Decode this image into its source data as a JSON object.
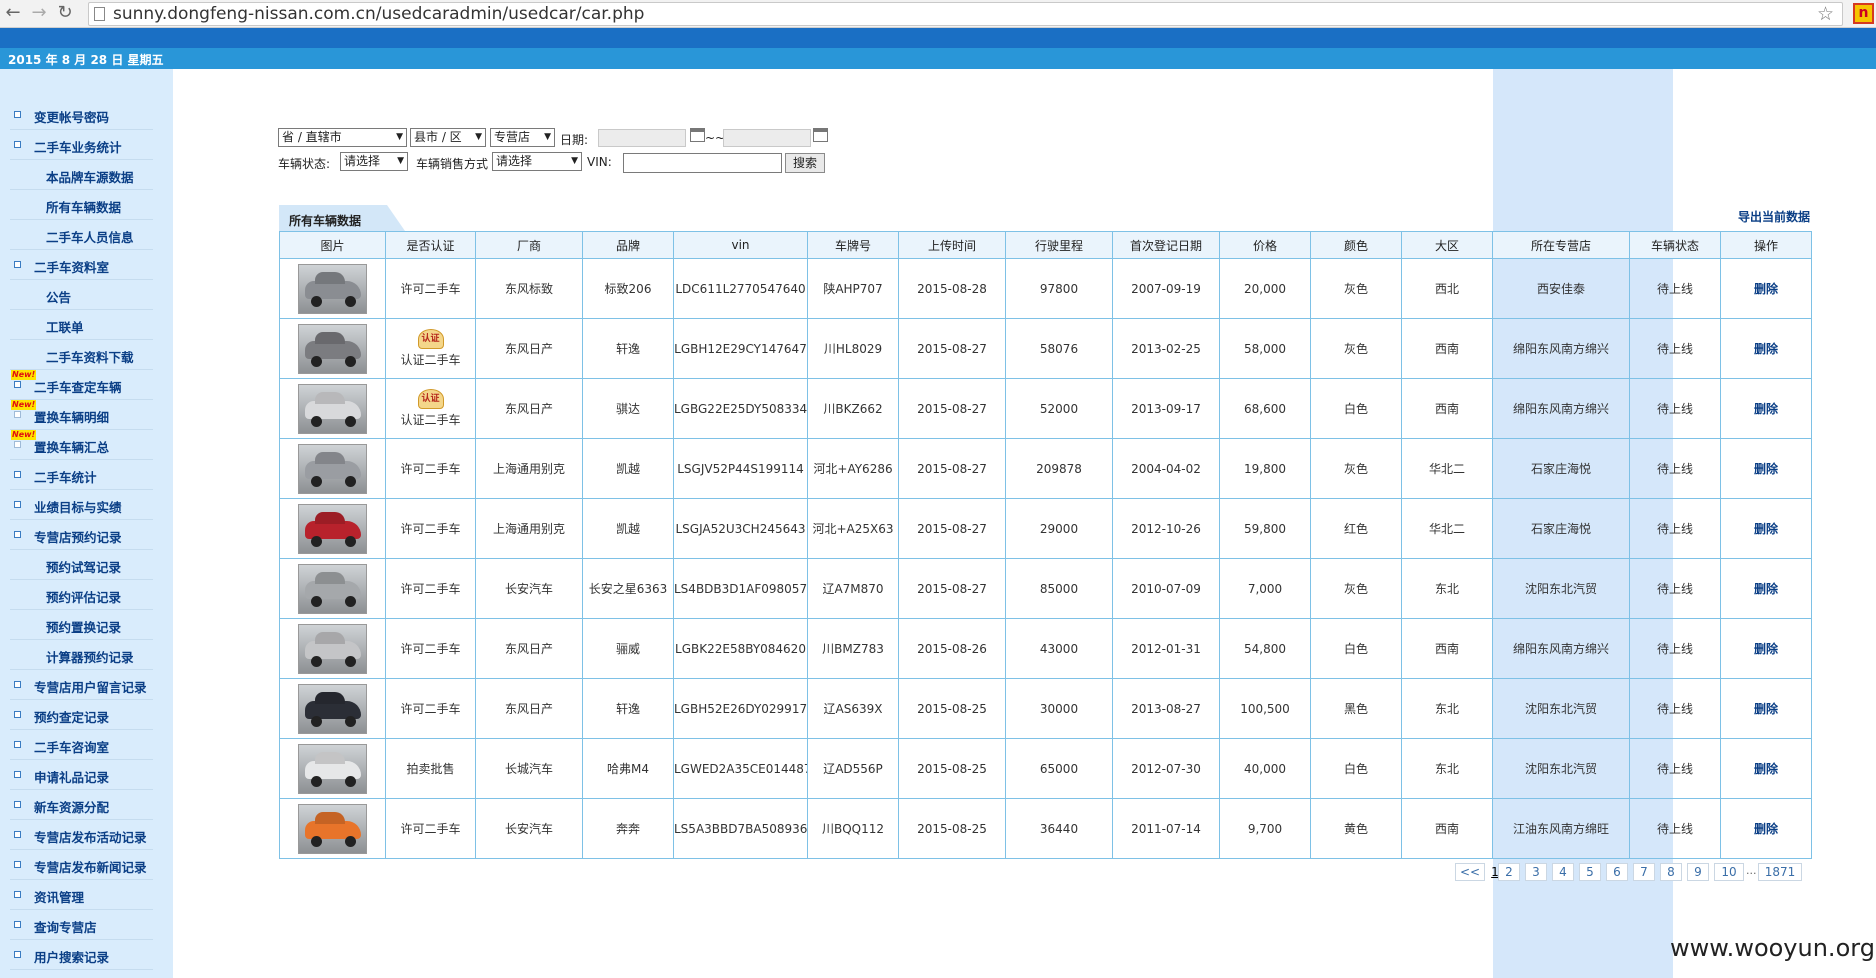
{
  "browser": {
    "url": "sunny.dongfeng-nissan.com.cn/usedcaradmin/usedcar/car.php"
  },
  "header": {
    "date": "2015 年 8 月 28 日 星期五"
  },
  "sidebar": {
    "items": [
      {
        "label": "变更帐号密码",
        "sub": false,
        "isNew": false
      },
      {
        "label": "二手车业务统计",
        "sub": false,
        "isNew": false
      },
      {
        "label": "本品牌车源数据",
        "sub": true,
        "isNew": false
      },
      {
        "label": "所有车辆数据",
        "sub": true,
        "isNew": false
      },
      {
        "label": "二手车人员信息",
        "sub": true,
        "isNew": false
      },
      {
        "label": "二手车资料室",
        "sub": false,
        "isNew": false
      },
      {
        "label": "公告",
        "sub": true,
        "isNew": false
      },
      {
        "label": "工联单",
        "sub": true,
        "isNew": false
      },
      {
        "label": "二手车资料下载",
        "sub": true,
        "isNew": false
      },
      {
        "label": "二手车查定车辆",
        "sub": false,
        "isNew": true
      },
      {
        "label": "置换车辆明细",
        "sub": false,
        "isNew": true
      },
      {
        "label": "置换车辆汇总",
        "sub": false,
        "isNew": true
      },
      {
        "label": "二手车统计",
        "sub": false,
        "isNew": false
      },
      {
        "label": "业绩目标与实绩",
        "sub": false,
        "isNew": false
      },
      {
        "label": "专营店预约记录",
        "sub": false,
        "isNew": false
      },
      {
        "label": "预约试驾记录",
        "sub": true,
        "isNew": false
      },
      {
        "label": "预约评估记录",
        "sub": true,
        "isNew": false
      },
      {
        "label": "预约置换记录",
        "sub": true,
        "isNew": false
      },
      {
        "label": "计算器预约记录",
        "sub": true,
        "isNew": false
      },
      {
        "label": "专营店用户留言记录",
        "sub": false,
        "isNew": false
      },
      {
        "label": "预约查定记录",
        "sub": false,
        "isNew": false
      },
      {
        "label": "二手车咨询室",
        "sub": false,
        "isNew": false
      },
      {
        "label": "申请礼品记录",
        "sub": false,
        "isNew": false
      },
      {
        "label": "新车资源分配",
        "sub": false,
        "isNew": false
      },
      {
        "label": "专营店发布活动记录",
        "sub": false,
        "isNew": false
      },
      {
        "label": "专营店发布新闻记录",
        "sub": false,
        "isNew": false
      },
      {
        "label": "资讯管理",
        "sub": false,
        "isNew": false
      },
      {
        "label": "查询专营店",
        "sub": false,
        "isNew": false
      },
      {
        "label": "用户搜索记录",
        "sub": false,
        "isNew": false
      }
    ],
    "new_tag": "New!"
  },
  "filters": {
    "province": "省 / 直辖市",
    "city": "县市 / 区",
    "store": "专营店",
    "date_label": "日期:",
    "date_sep": "~~",
    "status_label": "车辆状态:",
    "status_value": "请选择",
    "sale_label": "车辆销售方式",
    "sale_value": "请选择",
    "vin_label": "VIN:",
    "search_button": "搜索"
  },
  "section": {
    "title": "所有车辆数据",
    "export": "导出当前数据"
  },
  "table": {
    "headers": [
      "图片",
      "是否认证",
      "厂商",
      "品牌",
      "vin",
      "车牌号",
      "上传时间",
      "行驶里程",
      "首次登记日期",
      "价格",
      "颜色",
      "大区",
      "所在专营店",
      "车辆状态",
      "操作"
    ],
    "certified_badge": "认证",
    "rows": [
      {
        "car_color": "#8a8d92",
        "cert": "许可二手车",
        "certified": false,
        "maker": "东风标致",
        "brand": "标致206",
        "vin": "LDC611L2770547640",
        "plate": "陕AHP707",
        "upload": "2015-08-28",
        "mileage": "97800",
        "reg": "2007-09-19",
        "price": "20,000",
        "color": "灰色",
        "region": "西北",
        "store": "西安佳泰",
        "status": "待上线",
        "action": "删除"
      },
      {
        "car_color": "#7b7c80",
        "cert": "认证二手车",
        "certified": true,
        "maker": "东风日产",
        "brand": "轩逸",
        "vin": "LGBH12E29CY147647",
        "plate": "川HL8029",
        "upload": "2015-08-27",
        "mileage": "58076",
        "reg": "2013-02-25",
        "price": "58,000",
        "color": "灰色",
        "region": "西南",
        "store": "绵阳东风南方绵兴",
        "status": "待上线",
        "action": "删除"
      },
      {
        "car_color": "#d8d9db",
        "cert": "认证二手车",
        "certified": true,
        "maker": "东风日产",
        "brand": "骐达",
        "vin": "LGBG22E25DY508334",
        "plate": "川BKZ662",
        "upload": "2015-08-27",
        "mileage": "52000",
        "reg": "2013-09-17",
        "price": "68,600",
        "color": "白色",
        "region": "西南",
        "store": "绵阳东风南方绵兴",
        "status": "待上线",
        "action": "删除"
      },
      {
        "car_color": "#9a9da2",
        "cert": "许可二手车",
        "certified": false,
        "maker": "上海通用别克",
        "brand": "凯越",
        "vin": "LSGJV52P44S199114",
        "plate": "河北+AY6286",
        "upload": "2015-08-27",
        "mileage": "209878",
        "reg": "2004-04-02",
        "price": "19,800",
        "color": "灰色",
        "region": "华北二",
        "store": "石家庄海悦",
        "status": "待上线",
        "action": "删除"
      },
      {
        "car_color": "#b8222c",
        "cert": "许可二手车",
        "certified": false,
        "maker": "上海通用别克",
        "brand": "凯越",
        "vin": "LSGJA52U3CH245643",
        "plate": "河北+A25X63",
        "upload": "2015-08-27",
        "mileage": "29000",
        "reg": "2012-10-26",
        "price": "59,800",
        "color": "红色",
        "region": "华北二",
        "store": "石家庄海悦",
        "status": "待上线",
        "action": "删除"
      },
      {
        "car_color": "#a5a8ab",
        "cert": "许可二手车",
        "certified": false,
        "maker": "长安汽车",
        "brand": "长安之星6363",
        "vin": "LS4BDB3D1AF098057",
        "plate": "辽A7M870",
        "upload": "2015-08-27",
        "mileage": "85000",
        "reg": "2010-07-09",
        "price": "7,000",
        "color": "灰色",
        "region": "东北",
        "store": "沈阳东北汽贸",
        "status": "待上线",
        "action": "删除"
      },
      {
        "car_color": "#c4c5c7",
        "cert": "许可二手车",
        "certified": false,
        "maker": "东风日产",
        "brand": "骊威",
        "vin": "LGBK22E58BY084620",
        "plate": "川BMZ783",
        "upload": "2015-08-26",
        "mileage": "43000",
        "reg": "2012-01-31",
        "price": "54,800",
        "color": "白色",
        "region": "西南",
        "store": "绵阳东风南方绵兴",
        "status": "待上线",
        "action": "删除"
      },
      {
        "car_color": "#2b2e36",
        "cert": "许可二手车",
        "certified": false,
        "maker": "东风日产",
        "brand": "轩逸",
        "vin": "LGBH52E26DY029917",
        "plate": "辽AS639X",
        "upload": "2015-08-25",
        "mileage": "30000",
        "reg": "2013-08-27",
        "price": "100,500",
        "color": "黑色",
        "region": "东北",
        "store": "沈阳东北汽贸",
        "status": "待上线",
        "action": "删除"
      },
      {
        "car_color": "#e6e7e8",
        "cert": "拍卖批售",
        "certified": false,
        "maker": "长城汽车",
        "brand": "哈弗M4",
        "vin": "LGWED2A35CE014487",
        "plate": "辽AD556P",
        "upload": "2015-08-25",
        "mileage": "65000",
        "reg": "2012-07-30",
        "price": "40,000",
        "color": "白色",
        "region": "东北",
        "store": "沈阳东北汽贸",
        "status": "待上线",
        "action": "删除"
      },
      {
        "car_color": "#e8742a",
        "cert": "许可二手车",
        "certified": false,
        "maker": "长安汽车",
        "brand": "奔奔",
        "vin": "LS5A3BBD7BA508936",
        "plate": "川BQQ112",
        "upload": "2015-08-25",
        "mileage": "36440",
        "reg": "2011-07-14",
        "price": "9,700",
        "color": "黄色",
        "region": "西南",
        "store": "江油东风南方绵旺",
        "status": "待上线",
        "action": "删除"
      }
    ]
  },
  "pagination": {
    "prev": "<<",
    "current": "1",
    "pages": [
      "2",
      "3",
      "4",
      "5",
      "6",
      "7",
      "8",
      "9",
      "10"
    ],
    "dots": "...",
    "last": "1871"
  },
  "watermark": "www.wooyun.org"
}
